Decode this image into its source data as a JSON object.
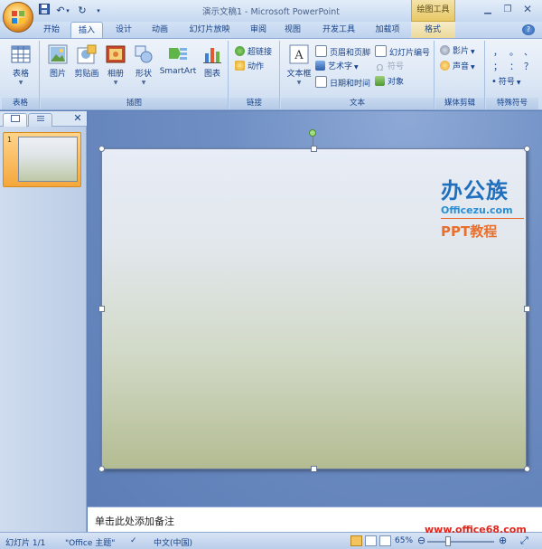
{
  "window": {
    "title": "演示文稿1 - Microsoft PowerPoint",
    "context_tool": "绘图工具"
  },
  "qat": {
    "save_icon": "save-icon",
    "undo_icon": "undo-icon",
    "redo_icon": "redo-icon"
  },
  "tabs": [
    "开始",
    "插入",
    "设计",
    "动画",
    "幻灯片放映",
    "审阅",
    "视图",
    "开发工具",
    "加载项",
    "格式"
  ],
  "active_tab": "插入",
  "ribbon": {
    "groups": {
      "tables": {
        "label": "表格",
        "table": "表格"
      },
      "illustrations": {
        "label": "插图",
        "picture": "图片",
        "clipart": "剪贴画",
        "album": "相册",
        "shapes": "形状",
        "smartart": "SmartArt",
        "chart": "图表"
      },
      "links": {
        "label": "链接",
        "hyperlink": "超链接",
        "action": "动作"
      },
      "text": {
        "label": "文本",
        "textbox": "文本框",
        "header_footer": "页眉和页脚",
        "wordart": "艺术字",
        "datetime": "日期和时间",
        "slide_number": "幻灯片编号",
        "symbol": "符号",
        "object": "对象"
      },
      "media": {
        "label": "媒体剪辑",
        "movie": "影片",
        "sound": "声音"
      },
      "special": {
        "label": "特殊符号",
        "symbol": "符号",
        "chars": [
          "，",
          "。",
          "、",
          "；",
          "：",
          "？"
        ]
      }
    }
  },
  "panel": {
    "tab1_icon": "slides-icon",
    "tab2_icon": "outline-icon",
    "slide_number": "1"
  },
  "slide": {
    "watermark_title": "办公族",
    "watermark_site": "Officezu.com",
    "watermark_sub": "PPT教程"
  },
  "notes": {
    "placeholder": "单击此处添加备注"
  },
  "status": {
    "slide_info": "幻灯片 1/1",
    "theme": "\"Office 主题\"",
    "language": "中文(中国)",
    "zoom": "65%"
  },
  "overlay_url": "www.office68.com"
}
